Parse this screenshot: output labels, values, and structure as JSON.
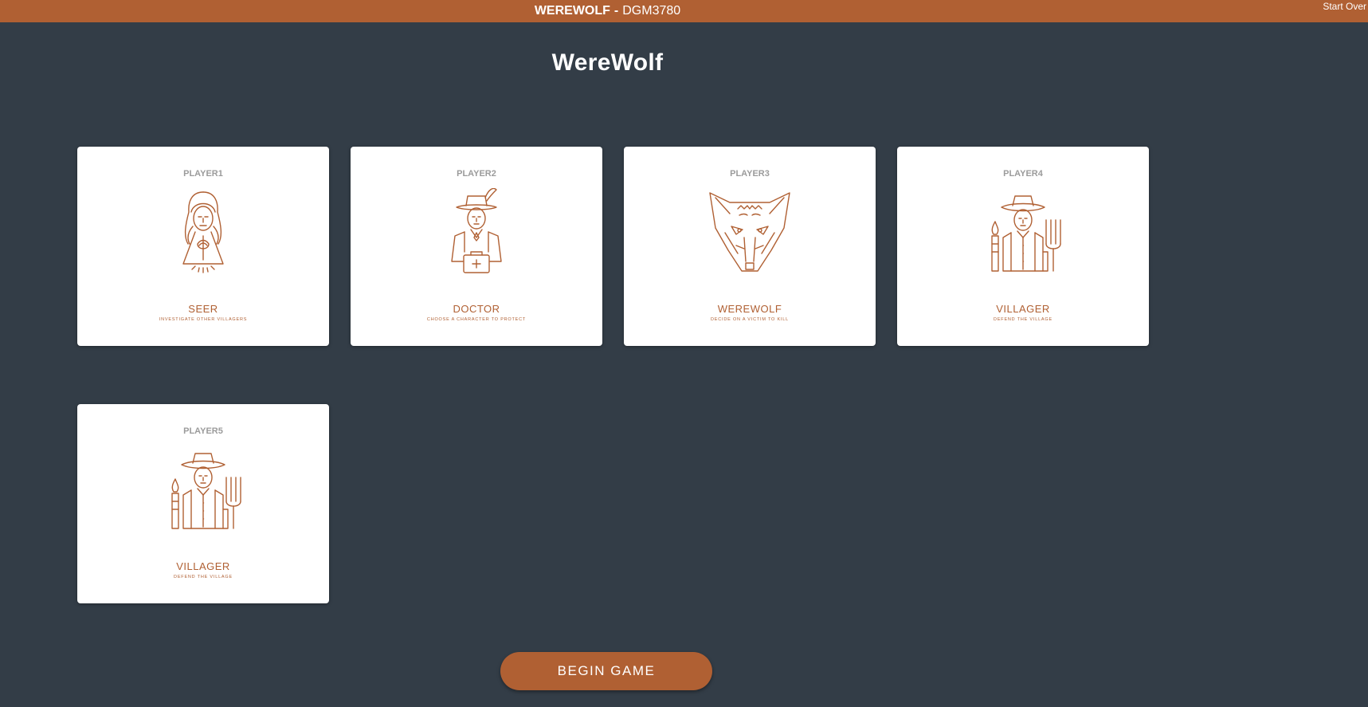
{
  "header": {
    "brand": "WEREWOLF",
    "separator": "-",
    "course": "DGM3780",
    "start_over": "Start Over"
  },
  "page_title": "WereWolf",
  "cards": [
    {
      "player": "PLAYER1",
      "role": "SEER",
      "description": "INVESTIGATE OTHER VILLAGERS",
      "icon": "seer-icon"
    },
    {
      "player": "PLAYER2",
      "role": "DOCTOR",
      "description": "CHOOSE A CHARACTER TO PROTECT",
      "icon": "doctor-icon"
    },
    {
      "player": "PLAYER3",
      "role": "WEREWOLF",
      "description": "DECIDE ON A VICTIM TO KILL",
      "icon": "werewolf-icon"
    },
    {
      "player": "PLAYER4",
      "role": "VILLAGER",
      "description": "DEFEND THE VILLAGE",
      "icon": "villager-icon"
    },
    {
      "player": "PLAYER5",
      "role": "VILLAGER",
      "description": "DEFEND THE VILLAGE",
      "icon": "villager-icon"
    }
  ],
  "begin_button": "BEGIN GAME",
  "colors": {
    "background": "#333d47",
    "accent": "#b06033",
    "card": "#ffffff",
    "muted": "#9b9b9b"
  }
}
